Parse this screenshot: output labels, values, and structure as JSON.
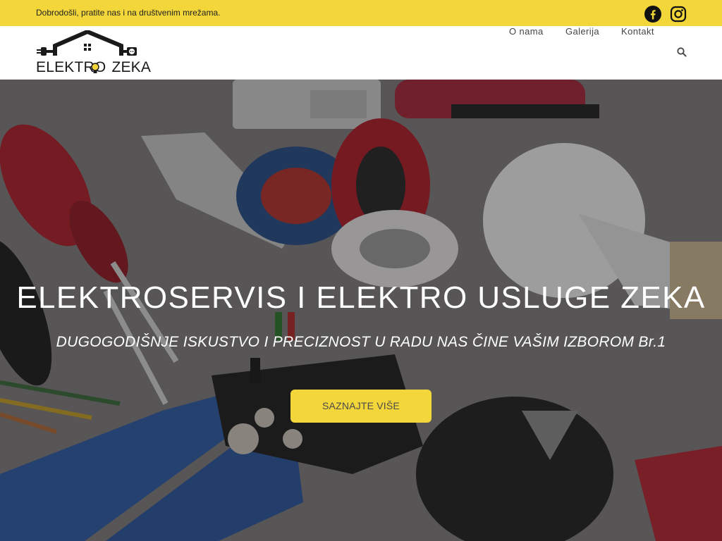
{
  "topbar": {
    "welcome_text": "Dobrodošli, pratite nas i na društvenim mrežama.",
    "social": [
      {
        "icon": "facebook-icon"
      },
      {
        "icon": "instagram-icon"
      }
    ],
    "background_color": "#f2d63a"
  },
  "header": {
    "logo": {
      "word1": "ELEKTRO",
      "word2": "ZEKA",
      "icon": "house-plug-logo"
    },
    "nav": [
      {
        "label": "O nama"
      },
      {
        "label": "Galerija"
      },
      {
        "label": "Kontakt"
      }
    ],
    "search_icon": "search-icon"
  },
  "hero": {
    "title": "ELEKTROSERVIS I ELEKTRO USLUGE ZEKA",
    "subtitle": "DUGOGODIŠNJE ISKUSTVO I PRECIZNOST U RADU NAS ČINE VAŠIM IZBOROM Br.1",
    "cta_label": "SAZNAJTE VIŠE",
    "cta_color": "#f2d63a"
  }
}
